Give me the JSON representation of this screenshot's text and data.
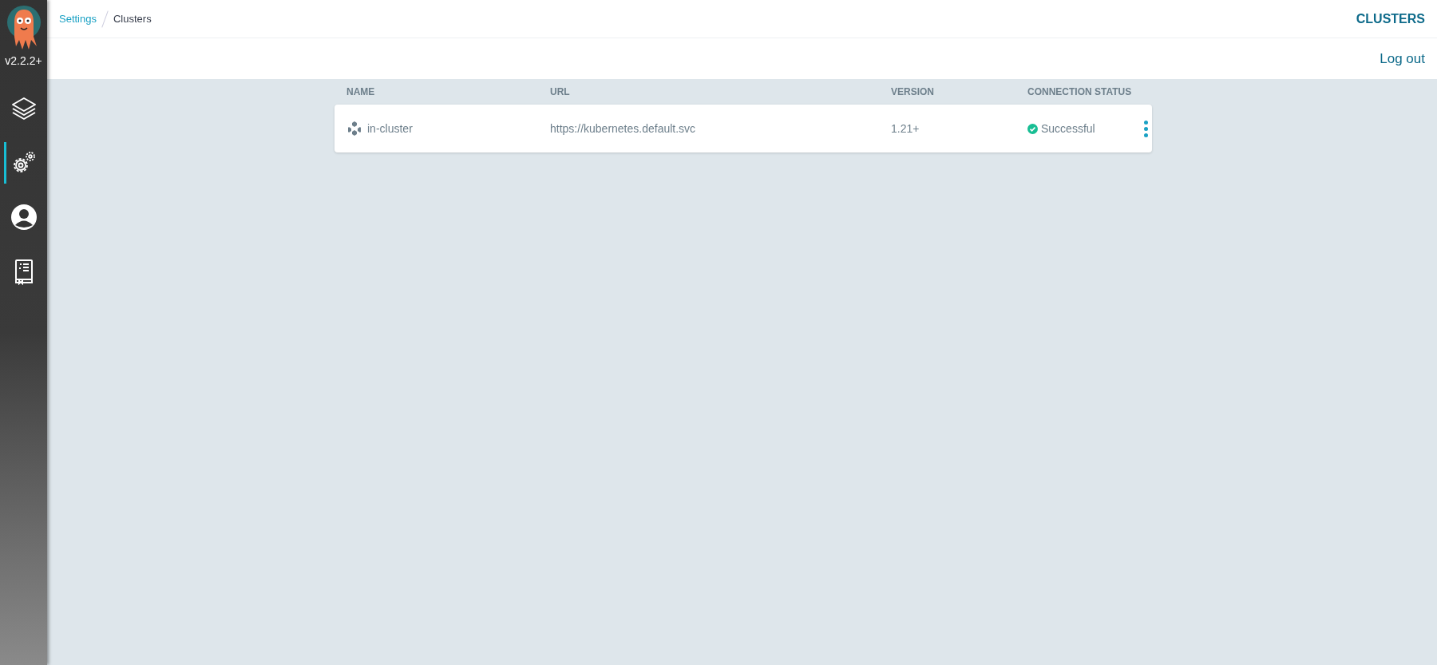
{
  "sidebar": {
    "version": "v2.2.2+",
    "items": [
      {
        "kind": "applications",
        "selected": false
      },
      {
        "kind": "settings",
        "selected": true
      },
      {
        "kind": "user",
        "selected": false
      },
      {
        "kind": "docs",
        "selected": false
      }
    ]
  },
  "breadcrumbs": [
    "Settings",
    "Clusters"
  ],
  "page_title": "CLUSTERS",
  "logout": "Log out",
  "table": {
    "columns": [
      "NAME",
      "URL",
      "VERSION",
      "CONNECTION STATUS"
    ],
    "rows": [
      {
        "name": "in-cluster",
        "url": "https://kubernetes.default.svc",
        "version": "1.21+",
        "status": "Successful",
        "connected": true
      }
    ]
  }
}
